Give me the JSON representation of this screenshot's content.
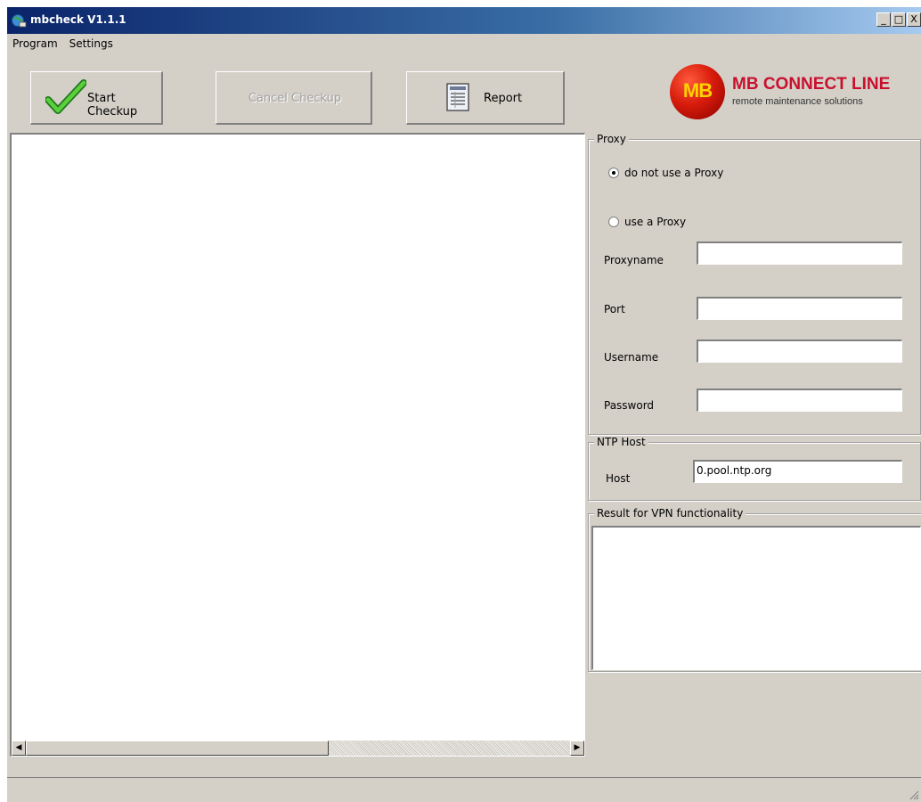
{
  "window": {
    "title": "mbcheck V1.1.1",
    "controls": [
      "_",
      "□",
      "X"
    ]
  },
  "menu": [
    "Program",
    "Settings"
  ],
  "toolbar": {
    "start_label": "Start Checkup",
    "cancel_label": "Cancel Checkup",
    "report_label": "Report"
  },
  "logo": {
    "badge": "MB",
    "name": "MB CONNECT LINE",
    "tagline": "remote maintenance solutions"
  },
  "proxy": {
    "group_title": "Proxy",
    "option_none": "do not use a Proxy",
    "option_use": "use a Proxy",
    "selected": "do not use a Proxy",
    "proxyname_label": "Proxyname",
    "proxyname_value": "",
    "port_label": "Port",
    "port_value": "",
    "username_label": "Username",
    "username_value": "",
    "password_label": "Password",
    "password_value": ""
  },
  "ntp": {
    "group_title": "NTP Host",
    "host_label": "Host",
    "host_value": "0.pool.ntp.org"
  },
  "result": {
    "group_title": "Result for VPN functionality"
  },
  "colors": {
    "face": "#d4d0c8",
    "title_start": "#0a246a",
    "title_end": "#a6caf0",
    "logo_red": "#c8102e",
    "logo_yellow": "#ffd200"
  },
  "icons": {
    "app": "network-globe-icon",
    "start": "checkmark-icon",
    "report": "report-document-icon",
    "grip": "resize-grip-icon"
  }
}
